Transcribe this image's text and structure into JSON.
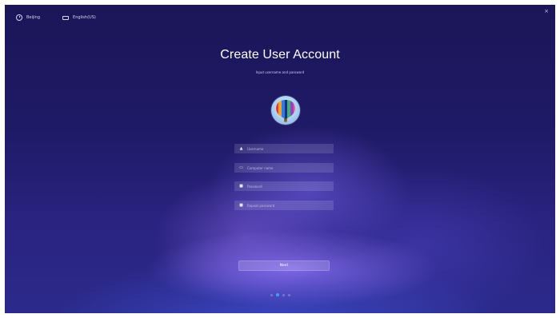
{
  "topbar": {
    "timezone_label": "Beijing",
    "timezone_icon": "clock-icon",
    "keyboard_label": "English(US)",
    "keyboard_icon": "keyboard-icon",
    "close_glyph": "×"
  },
  "main": {
    "title": "Create User Account",
    "subtitle": "Input username and password",
    "avatar_icon": "hot-air-balloon-avatar"
  },
  "form": {
    "fields": [
      {
        "icon": "user-icon",
        "glyph": "▲",
        "placeholder": "Username",
        "value": ""
      },
      {
        "icon": "computer-icon",
        "glyph": "▭",
        "placeholder": "Computer name",
        "value": ""
      },
      {
        "icon": "lock-icon",
        "glyph": "■",
        "placeholder": "Password",
        "value": ""
      },
      {
        "icon": "lock-icon",
        "glyph": "■",
        "placeholder": "Repeat password",
        "value": ""
      }
    ],
    "next_label": "Next"
  },
  "pagination": {
    "total": 4,
    "current": 2
  },
  "colors": {
    "background": "#1f1a66",
    "accent": "#3aa0ff"
  }
}
